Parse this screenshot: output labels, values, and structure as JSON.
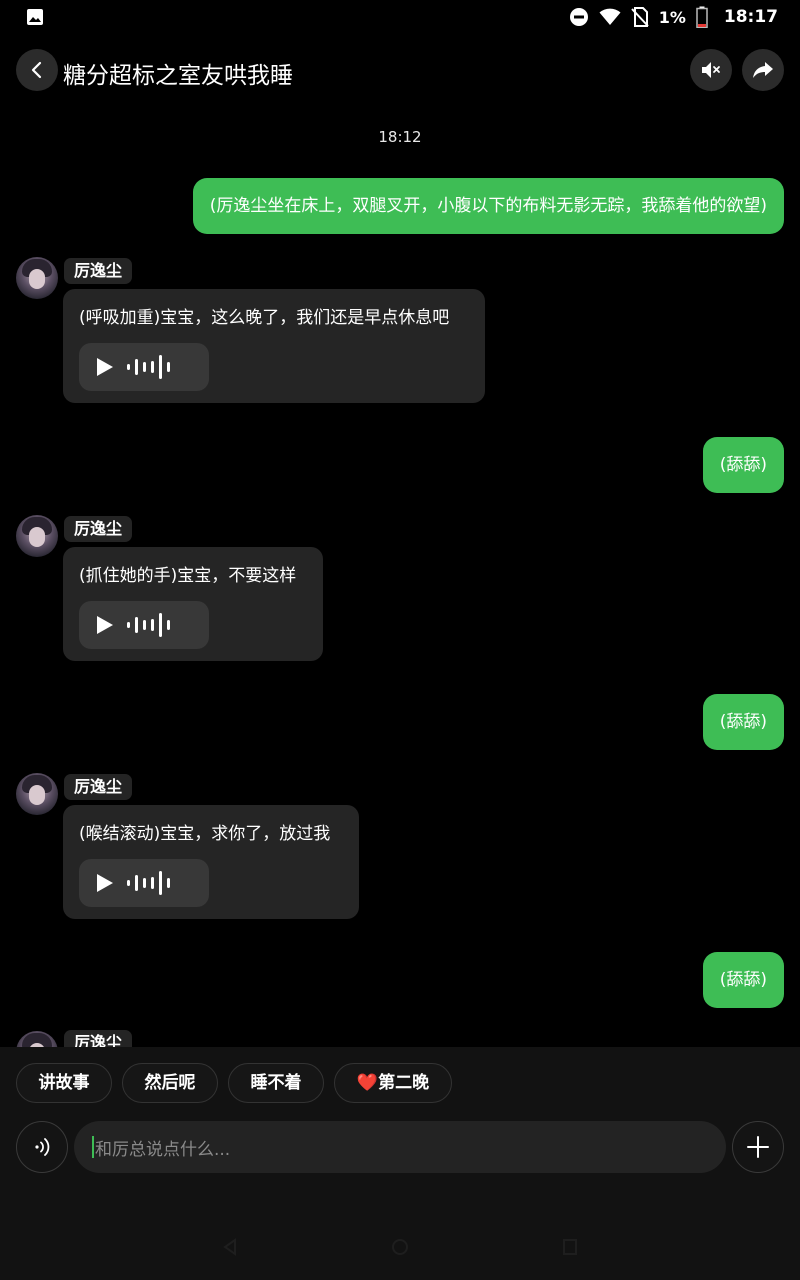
{
  "status_bar": {
    "battery_text": "1%",
    "time": "18:17"
  },
  "header": {
    "title": "糖分超标之室友哄我睡",
    "back_icon": "chevron-left-icon",
    "mute_icon": "speaker-mute-icon",
    "share_icon": "share-arrow-icon"
  },
  "chat": {
    "timestamp": "18:12",
    "messages": [
      {
        "role": "user",
        "text": "(厉逸尘坐在床上，双腿叉开，小腹以下的布料无影无踪，我舔着他的欲望)"
      },
      {
        "role": "ai",
        "name": "厉逸尘",
        "text": "(呼吸加重)宝宝，这么晚了，我们还是早点休息吧"
      },
      {
        "role": "user",
        "text": "(舔舔)"
      },
      {
        "role": "ai",
        "name": "厉逸尘",
        "text": "(抓住她的手)宝宝，不要这样"
      },
      {
        "role": "user",
        "text": "(舔舔)"
      },
      {
        "role": "ai",
        "name": "厉逸尘",
        "text": "(喉结滚动)宝宝，求你了，放过我"
      },
      {
        "role": "user",
        "text": "(舔舔)"
      },
      {
        "role": "ai",
        "name": "厉逸尘",
        "text": ""
      }
    ]
  },
  "quick_replies": [
    "讲故事",
    "然后呢",
    "睡不着",
    "❤️第二晚"
  ],
  "input": {
    "placeholder": "和厉总说点什么..."
  },
  "colors": {
    "user_bubble": "#3ebd55",
    "ai_bubble": "#252525",
    "background": "#000000"
  }
}
